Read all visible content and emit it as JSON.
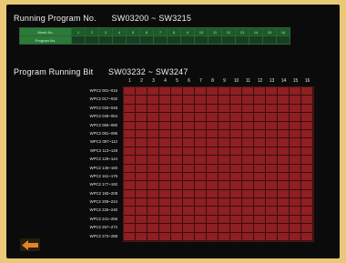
{
  "running_program": {
    "title": "Running Program No.",
    "registers": "SW03200 ~ SW3215",
    "row1_label": "Week No.",
    "row2_label": "Program No.",
    "numbers": [
      "1",
      "2",
      "3",
      "4",
      "5",
      "6",
      "7",
      "8",
      "9",
      "10",
      "11",
      "12",
      "13",
      "14",
      "15",
      "16"
    ]
  },
  "program_bit": {
    "title": "Program Running Bit",
    "registers": "SW03232 ~ SW3247",
    "columns": [
      "1",
      "2",
      "3",
      "4",
      "5",
      "6",
      "7",
      "8",
      "9",
      "10",
      "11",
      "12",
      "13",
      "14",
      "15",
      "16"
    ],
    "rows": [
      "WPC2 001~016",
      "WPC2 017~032",
      "WPC2 033~048",
      "WPC2 049~064",
      "WPC2 065~080",
      "WPC2 081~096",
      "WPC2 097~112",
      "WPC2 113~128",
      "WPC2 129~144",
      "WPC2 145~160",
      "WPC2 161~176",
      "WPC2 177~192",
      "WPC2 193~208",
      "WPC2 209~224",
      "WPC2 225~240",
      "WPC2 241~256",
      "WPC2 257~272",
      "WPC2 273~288"
    ]
  },
  "colors": {
    "background": "#e9c978",
    "screen": "#0b0b0b",
    "bit_cell": "#8e1f22",
    "program_header": "#2b7a38"
  },
  "icons": {
    "back": "back-arrow-icon"
  }
}
